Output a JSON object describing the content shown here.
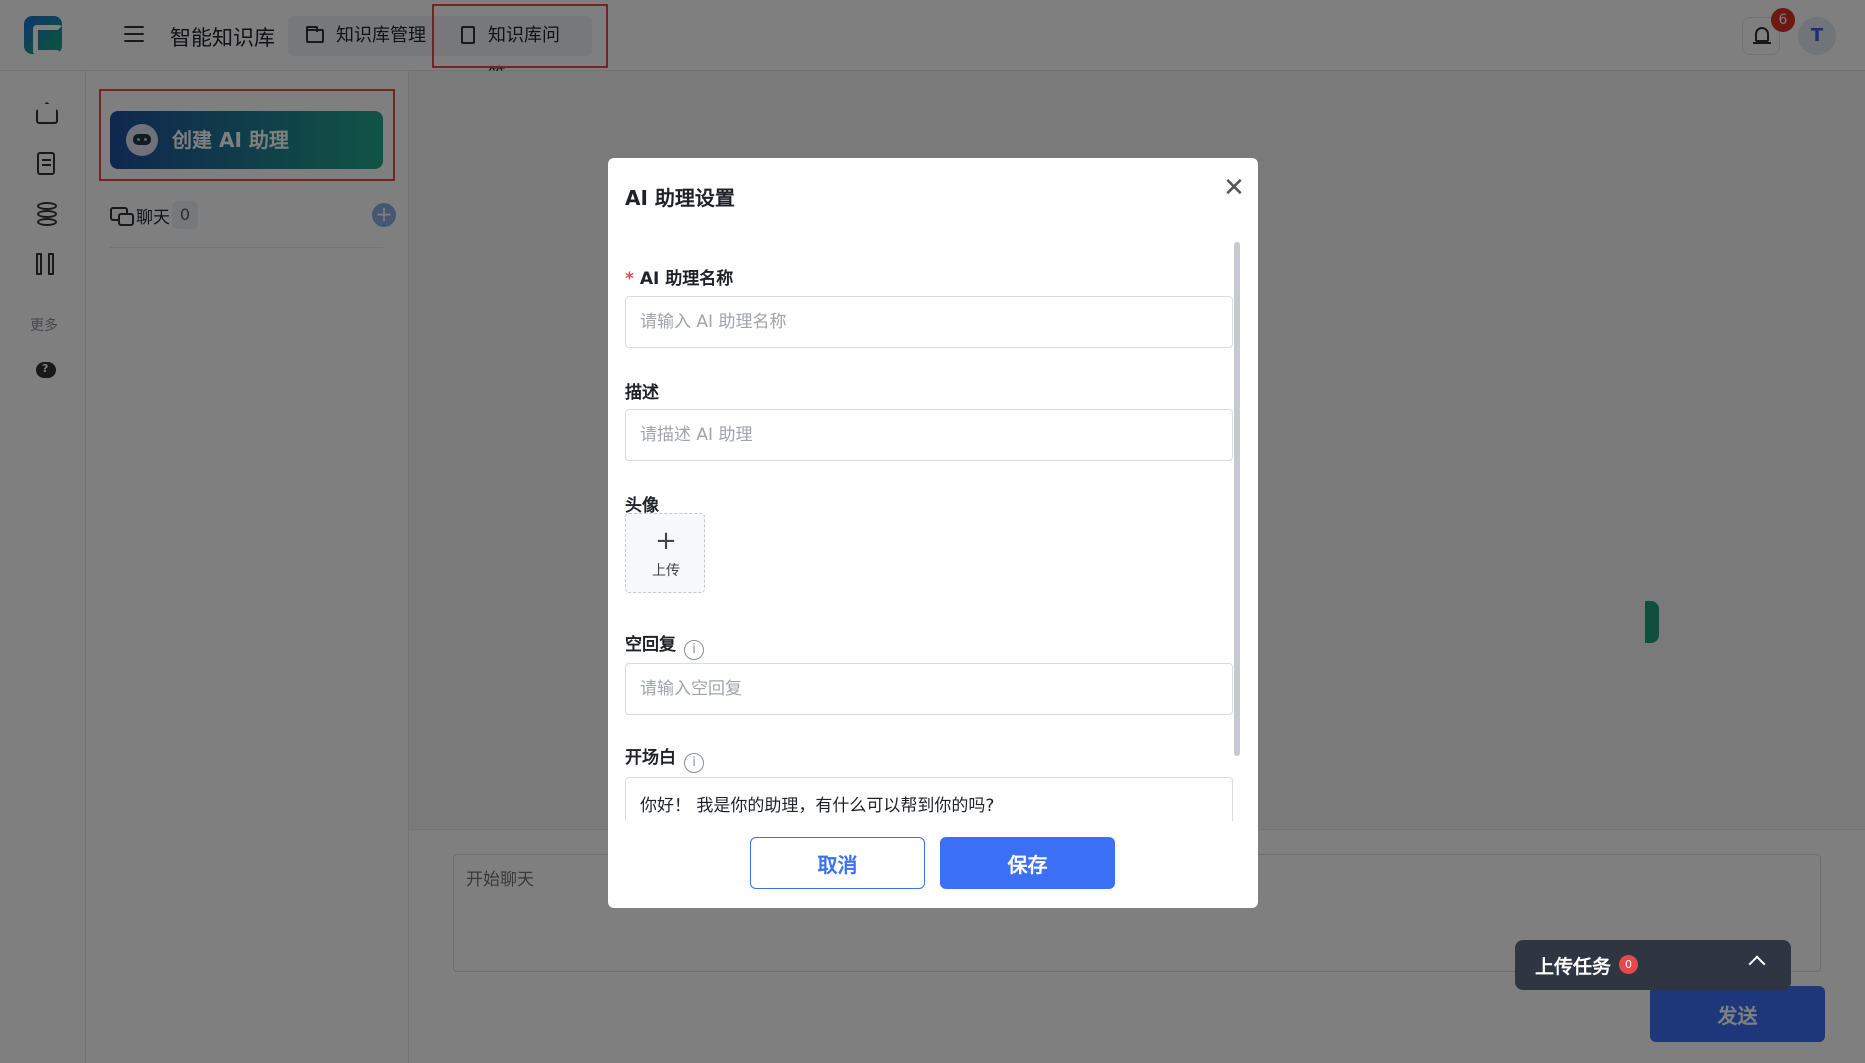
{
  "header": {
    "app_title": "智能知识库",
    "tabs": [
      {
        "label": "知识库管理",
        "icon": "folder-icon"
      },
      {
        "label": "知识库问答",
        "icon": "document-icon"
      }
    ],
    "notification_count": "6",
    "avatar_initial": "T"
  },
  "rail": {
    "items": [
      "home-icon",
      "document-icon",
      "database-icon",
      "columns-icon"
    ],
    "more_label": "更多",
    "extra_items": [
      "chat-help-icon"
    ]
  },
  "sidebar": {
    "create_button_label": "创建 AI 助理",
    "chat_label": "聊天",
    "chat_count": "0"
  },
  "compose": {
    "placeholder": "开始聊天",
    "send_label": "发送"
  },
  "upload_panel": {
    "title": "上传任务",
    "count": "0"
  },
  "modal": {
    "title": "AI 助理设置",
    "fields": {
      "name": {
        "label": "AI 助理名称",
        "placeholder": "请输入 AI 助理名称",
        "required_mark": "*"
      },
      "description": {
        "label": "描述",
        "placeholder": "请描述 AI 助理"
      },
      "avatar": {
        "label": "头像",
        "upload_label": "上传"
      },
      "empty_reply": {
        "label": "空回复",
        "placeholder": "请输入空回复"
      },
      "opening": {
        "label": "开场白",
        "value": "你好！ 我是你的助理，有什么可以帮到你的吗?"
      }
    },
    "cancel_label": "取消",
    "save_label": "保存"
  },
  "colors": {
    "primary": "#3b6ff5",
    "highlight": "#e5484d",
    "badge": "#d93026"
  }
}
